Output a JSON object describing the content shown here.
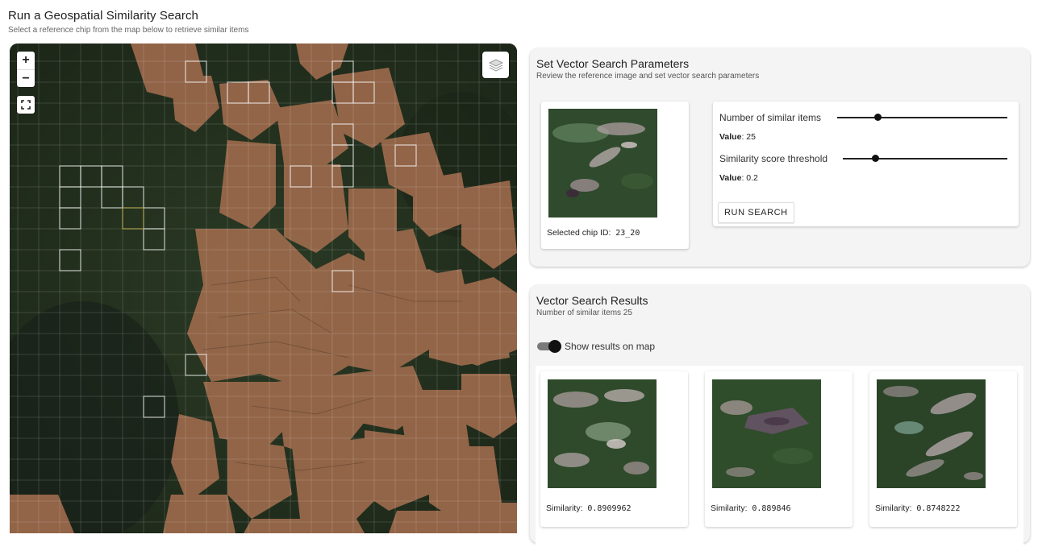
{
  "header": {
    "title": "Run a Geospatial Similarity Search",
    "subtitle": "Select a reference chip from the map below to retrieve similar items"
  },
  "map": {
    "zoom_in_label": "+",
    "zoom_out_label": "−",
    "icons": [
      "fullscreen-icon",
      "layers-icon"
    ]
  },
  "params": {
    "title": "Set Vector Search Parameters",
    "subtitle": "Review the reference image and set vector search parameters",
    "selected_chip_label": "Selected chip ID:",
    "selected_chip_id": "23_20",
    "slider_items": {
      "label": "Number of similar items",
      "value_prefix": "Value",
      "value": "25",
      "fraction": 0.24
    },
    "slider_threshold": {
      "label": "Similarity score threshold",
      "value_prefix": "Value",
      "value": "0.2",
      "fraction": 0.2
    },
    "run_button": "RUN SEARCH"
  },
  "results": {
    "title": "Vector Search Results",
    "subtitle": "Number of similar items 25",
    "toggle_label": "Show results on map",
    "toggle_on": true,
    "similarity_label": "Similarity:",
    "items": [
      {
        "similarity": "0.8909962"
      },
      {
        "similarity": "0.889846"
      },
      {
        "similarity": "0.8748222"
      }
    ]
  },
  "colors": {
    "forest": "#25331f",
    "cleared_land": "#9c6a4c",
    "panel_bg": "#f4f4f4"
  }
}
